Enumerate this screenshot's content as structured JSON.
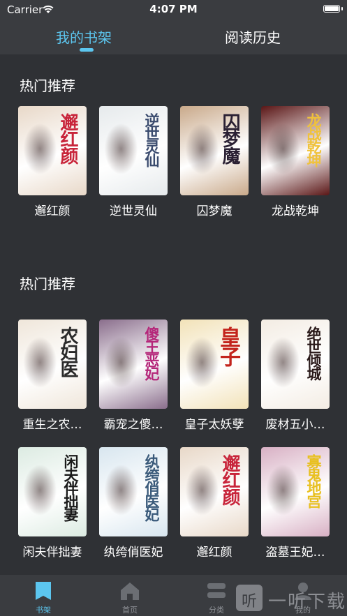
{
  "status_bar": {
    "carrier": "Carrier",
    "time": "4:07 PM"
  },
  "tabs": [
    {
      "label": "我的书架",
      "active": true
    },
    {
      "label": "阅读历史",
      "active": false
    }
  ],
  "sections": [
    {
      "title": "热门推荐",
      "books": [
        {
          "name": "邂红颜",
          "cover_text": "邂红颜",
          "cover_color": "#e8d8c8",
          "text_color": "#c8243a"
        },
        {
          "name": "逆世灵仙",
          "cover_text": "逆世灵仙",
          "cover_color": "#e6eaec",
          "text_color": "#3a4b6e"
        },
        {
          "name": "囚梦魔",
          "cover_text": "囚梦魔",
          "cover_color": "#c9a98a",
          "text_color": "#2a2033"
        },
        {
          "name": "龙战乾坤",
          "cover_text": "龙战乾坤",
          "cover_color": "#5a1616",
          "text_color": "#f0c23a"
        }
      ]
    },
    {
      "title": "热门推荐",
      "books": [
        {
          "name": "重生之农…",
          "cover_text": "农妇医",
          "cover_color": "#efe6da",
          "text_color": "#2a2a2a"
        },
        {
          "name": "霸宠之傻…",
          "cover_text": "傻王恶妃",
          "cover_color": "#8a6e8c",
          "text_color": "#b5277a"
        },
        {
          "name": "皇子太妖孽",
          "cover_text": "皇子",
          "cover_color": "#f2e2b8",
          "text_color": "#c3241c"
        },
        {
          "name": "废材五小…",
          "cover_text": "绝世倾城",
          "cover_color": "#f3ece3",
          "text_color": "#2a1a1a"
        },
        {
          "name": "闲夫伴拙妻",
          "cover_text": "闲夫伴拙妻",
          "cover_color": "#dcebe2",
          "text_color": "#1a1a1a"
        },
        {
          "name": "纨绔俏医妃",
          "cover_text": "纨绔俏医妃",
          "cover_color": "#d8e6ef",
          "text_color": "#3a5a7a"
        },
        {
          "name": "邂红颜",
          "cover_text": "邂红颜",
          "cover_color": "#e8d8c8",
          "text_color": "#c8243a"
        },
        {
          "name": "盗墓王妃…",
          "cover_text": "寡鬼地宫",
          "cover_color": "#d8b0c4",
          "text_color": "#e8c020"
        }
      ]
    }
  ],
  "bottom_nav": [
    {
      "label": "书架",
      "icon": "bookmark-icon",
      "active": true
    },
    {
      "label": "首页",
      "icon": "home-icon",
      "active": false
    },
    {
      "label": "分类",
      "icon": "category-icon",
      "active": false
    },
    {
      "label": "我的",
      "icon": "profile-icon",
      "active": false
    }
  ],
  "watermark": {
    "glyph": "听",
    "text": "一听下载"
  },
  "colors": {
    "accent": "#5cc6ef",
    "background": "#2f3135",
    "bar": "#3a3c40"
  }
}
